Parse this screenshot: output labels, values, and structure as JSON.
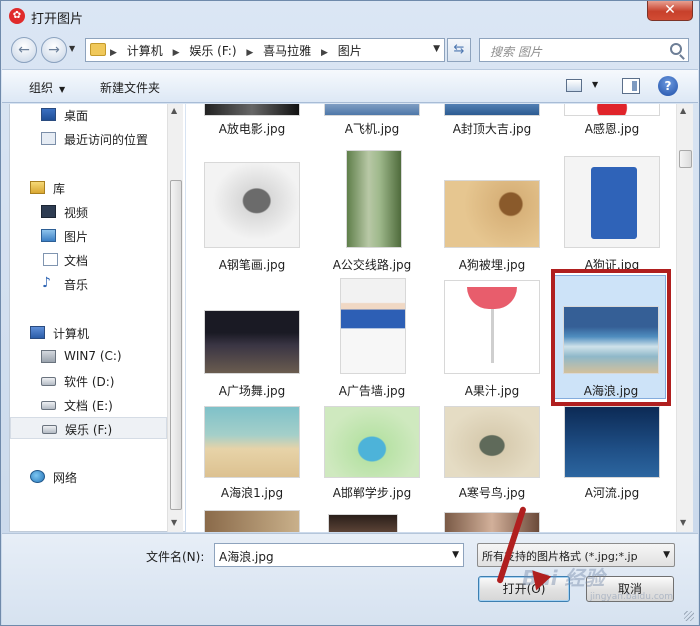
{
  "window": {
    "title": "打开图片",
    "app_icon": "红色圆形图标",
    "close_label": "✕"
  },
  "nav": {
    "back": "←",
    "forward": "→",
    "breadcrumb": [
      "计算机",
      "娱乐 (F:)",
      "喜马拉雅",
      "图片"
    ],
    "search_placeholder": "搜索 图片"
  },
  "toolbar": {
    "organize": "组织",
    "new_folder": "新建文件夹",
    "help": "?"
  },
  "sidebar": {
    "items": [
      {
        "label": "桌面",
        "icon": "desktop-icon"
      },
      {
        "label": "最近访问的位置",
        "icon": "recent-places-icon"
      },
      {
        "label": "库",
        "icon": "library-icon"
      },
      {
        "label": "视频",
        "icon": "videos-icon"
      },
      {
        "label": "图片",
        "icon": "pictures-icon"
      },
      {
        "label": "文档",
        "icon": "documents-icon"
      },
      {
        "label": "音乐",
        "icon": "music-icon"
      },
      {
        "label": "计算机",
        "icon": "computer-icon"
      },
      {
        "label": "WIN7 (C:)",
        "icon": "windows-drive-icon"
      },
      {
        "label": "软件 (D:)",
        "icon": "drive-icon"
      },
      {
        "label": "文档 (E:)",
        "icon": "drive-icon"
      },
      {
        "label": "娱乐 (F:)",
        "icon": "drive-icon",
        "selected": true
      },
      {
        "label": "网络",
        "icon": "network-icon"
      }
    ]
  },
  "files": [
    {
      "name": "A放电影.jpg"
    },
    {
      "name": "A飞机.jpg"
    },
    {
      "name": "A封顶大吉.jpg"
    },
    {
      "name": "A感恩.jpg"
    },
    {
      "name": "A钢笔画.jpg"
    },
    {
      "name": "A公交线路.jpg"
    },
    {
      "name": "A狗被埋.jpg"
    },
    {
      "name": "A狗证.jpg"
    },
    {
      "name": "A广场舞.jpg"
    },
    {
      "name": "A广告墙.jpg"
    },
    {
      "name": "A果汁.jpg"
    },
    {
      "name": "A海浪.jpg",
      "selected": true
    },
    {
      "name": "A海浪1.jpg"
    },
    {
      "name": "A邯郸学步.jpg"
    },
    {
      "name": "A寒号鸟.jpg"
    },
    {
      "name": "A河流.jpg"
    }
  ],
  "bottom": {
    "filename_label": "文件名(N):",
    "filename_value": "A海浪.jpg",
    "filter_value": "所有支持的图片格式 (*.jpg;*.jp",
    "open_label": "打开(O)",
    "cancel_label": "取消"
  },
  "watermark": {
    "text": "Bai 经验",
    "url": "jingyan.baidu.com"
  },
  "colors": {
    "highlight": "#b01f1f",
    "selection": "#cde3f8"
  }
}
